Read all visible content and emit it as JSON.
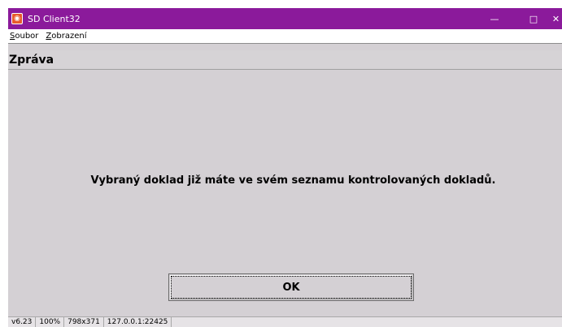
{
  "window": {
    "title": "SD Client32",
    "icon": "app-icon",
    "controls": {
      "minimize": "—",
      "maximize": "□",
      "close": "✕"
    }
  },
  "menu": {
    "items": [
      {
        "accel": "S",
        "rest": "oubor"
      },
      {
        "accel": "Z",
        "rest": "obrazení"
      }
    ]
  },
  "header": {
    "title": "Zpráva"
  },
  "main": {
    "message": "Vybraný doklad již máte ve svém seznamu kontrolovaných dokladů.",
    "ok_label": "OK"
  },
  "status": {
    "version": "v6.23",
    "zoom": "100%",
    "resolution": "798x371",
    "address": "127.0.0.1:22425"
  },
  "colors": {
    "titlebar": "#8b1a9b",
    "background": "#d4d0d4"
  }
}
